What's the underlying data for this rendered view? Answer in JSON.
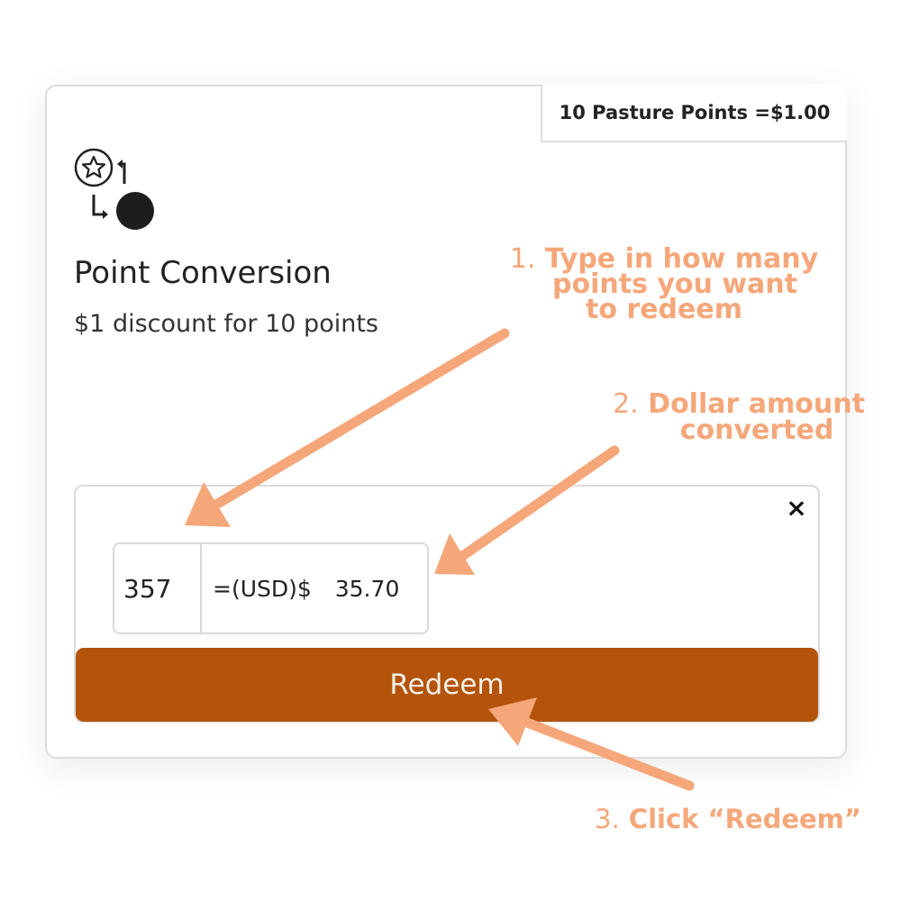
{
  "card": {
    "rate_badge": "10 Pasture Points =$1.00",
    "icon": "points-conversion-icon",
    "title": "Point Conversion",
    "subtitle": "$1 discount for 10 points"
  },
  "redeem_panel": {
    "close_label": "×",
    "points_value": "357",
    "currency_label": "=(USD)$",
    "usd_value": "35.70",
    "redeem_label": "Redeem"
  },
  "annotations": {
    "step1_number": "1.",
    "step1_line1": "Type in how many",
    "step1_line2": "points you want",
    "step1_line3": "to redeem",
    "step2_number": "2.",
    "step2_line1": "Dollar amount",
    "step2_line2": "converted",
    "step3_number": "3.",
    "step3_text": "Click “Redeem”"
  },
  "colors": {
    "redeem_button": "#b3540a",
    "annotation": "#f5a77a",
    "text": "#222222"
  }
}
